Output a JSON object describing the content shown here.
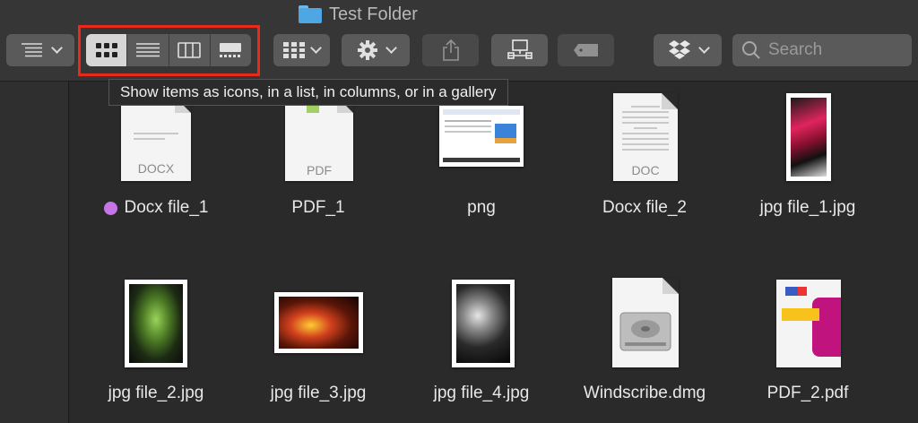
{
  "window": {
    "title": "Test Folder"
  },
  "toolbar": {
    "view_modes": [
      "icons",
      "list",
      "columns",
      "gallery"
    ],
    "active_view": "icons",
    "search_placeholder": "Search"
  },
  "tooltip": "Show items as icons, in a list, in columns, or in a gallery",
  "files": [
    {
      "name": "Docx file_1",
      "ext": "DOCX",
      "tag_color": "#c774e8"
    },
    {
      "name": "PDF_1",
      "ext": "PDF"
    },
    {
      "name": "png"
    },
    {
      "name": "Docx file_2",
      "ext": "DOC"
    },
    {
      "name": "jpg file_1.jpg"
    },
    {
      "name": "jpg file_2.jpg"
    },
    {
      "name": "jpg file_3.jpg"
    },
    {
      "name": "jpg file_4.jpg"
    },
    {
      "name": "Windscribe.dmg"
    },
    {
      "name": "PDF_2.pdf"
    }
  ],
  "colors": {
    "highlight": "#e8291c",
    "folder": "#4ea6e3"
  }
}
